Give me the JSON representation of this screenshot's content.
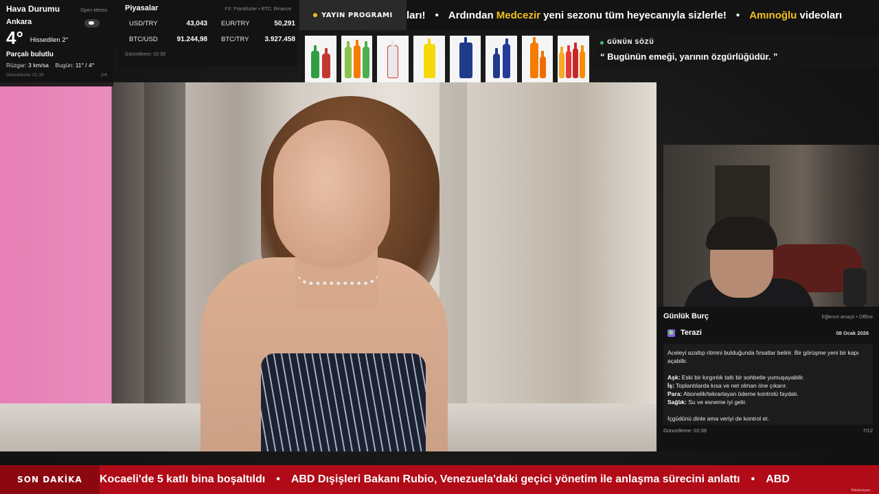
{
  "weather": {
    "title": "Hava Durumu",
    "source": "Open-Meteo",
    "city": "Ankara",
    "icon": "partly-cloudy-icon",
    "temp": "4°",
    "feels": "Hissedilen 2°",
    "condition": "Parçalı bulutlu",
    "wind_label": "Rüzgar:",
    "wind_value": "3 km/sa",
    "today_label": "Bugün:",
    "today_value": "11° / 4°",
    "updated": "Güncelleme: 02:39",
    "page": "2/4"
  },
  "markets": {
    "title": "Piyasalar",
    "source": "FX: Frankfurter • BTC: Binance",
    "rows": [
      {
        "label": "USD/TRY",
        "value": "43,043",
        "label2": "EUR/TRY",
        "value2": "50,291"
      },
      {
        "label": "BTC/USD",
        "value": "91.244,98",
        "label2": "BTC/TRY",
        "value2": "3.927.458"
      }
    ],
    "updated": "Güncelleme: 02:39"
  },
  "schedule_button": "YAYIN PROGRAMI",
  "top_ticker": {
    "segments": [
      {
        "text": "ları!",
        "highlight": ""
      },
      {
        "text": "Ardından ",
        "highlight": "Medcezir",
        "after": " yeni sezonu tüm heyecanıyla sizlerle!"
      },
      {
        "text": "",
        "highlight": "Amınoğlu",
        "after": " videoları"
      }
    ],
    "separator": "•"
  },
  "quote": {
    "label": "GÜNÜN SÖZÜ",
    "text": "“ Bugünün emeği, yarının özgürlüğüdür. ”"
  },
  "horoscope": {
    "title": "Günlük Burç",
    "note": "Eğlence amaçlı • Offline",
    "sign": "Terazi",
    "sign_icon": "libra-icon",
    "date": "08 Ocak 2026",
    "intro": "Aceleyi azaltıp ritmini bulduğunda fırsatlar belirir. Bir görüşme yeni bir kapı açabilir.",
    "items": [
      {
        "k": "Aşk:",
        "v": " Eski bir kırgınlık tatlı bir sohbetle yumuşayabilir."
      },
      {
        "k": "İş:",
        "v": " Toplantılarda kısa ve net olman öne çıkarır."
      },
      {
        "k": "Para:",
        "v": " Abonelik/tekrarlayan ödeme kontrolü faydalı."
      },
      {
        "k": "Sağlık:",
        "v": " Su ve esneme iyi gelir."
      }
    ],
    "closing": "İçgüdünü dinle ama veriyi de kontrol et.",
    "updated": "Güncelleme: 02:39",
    "page": "7/12"
  },
  "news": {
    "label": "SON DAKİKA",
    "items": [
      "Kocaeli'de 5 katlı bina boşaltıldı",
      "ABD Dışişleri Bakanı Rubio, Venezuela'daki geçici yönetim ile anlaşma sürecini anlattı",
      "ABD"
    ],
    "separator": "•",
    "footer": "Yükleniyor..."
  },
  "colors": {
    "accent_yellow": "#f2c01e",
    "news_red": "#b10b17",
    "live_green": "#3ec46d"
  }
}
